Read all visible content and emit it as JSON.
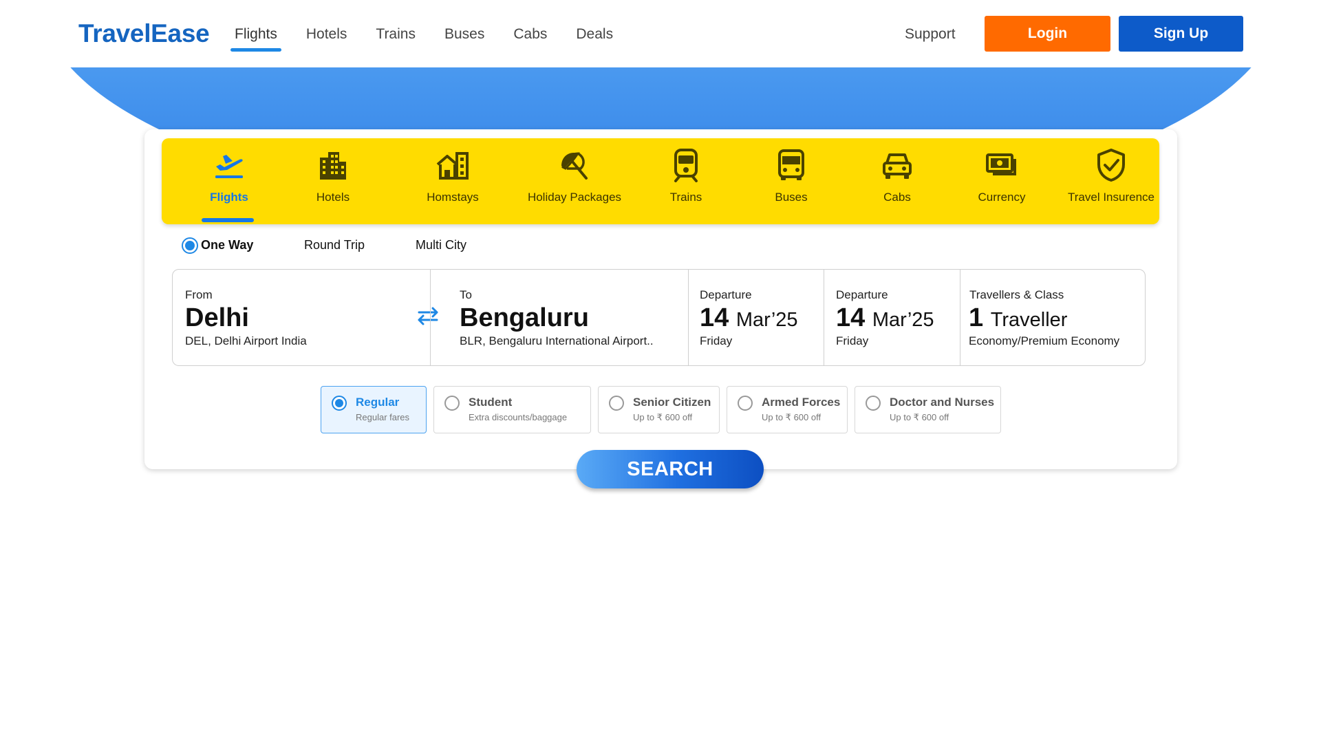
{
  "brand": {
    "name": "TravelEase",
    "color": "#1565c0"
  },
  "nav": {
    "items": [
      {
        "label": "Flights",
        "active": true
      },
      {
        "label": "Hotels"
      },
      {
        "label": "Trains"
      },
      {
        "label": "Buses"
      },
      {
        "label": "Cabs"
      },
      {
        "label": "Deals"
      }
    ],
    "support": "Support",
    "login": "Login",
    "signup": "Sign Up"
  },
  "categories": [
    {
      "label": "Flights",
      "icon": "plane-takeoff-icon",
      "active": true
    },
    {
      "label": "Hotels",
      "icon": "building-icon"
    },
    {
      "label": "Homstays",
      "icon": "homestay-icon"
    },
    {
      "label": "Holiday Packages",
      "icon": "beach-umbrella-icon"
    },
    {
      "label": "Trains",
      "icon": "train-icon"
    },
    {
      "label": "Buses",
      "icon": "bus-icon"
    },
    {
      "label": "Cabs",
      "icon": "car-icon"
    },
    {
      "label": "Currency",
      "icon": "banknote-icon"
    },
    {
      "label": "Travel Insurence",
      "icon": "shield-check-icon"
    }
  ],
  "trip_types": [
    {
      "label": "One Way",
      "selected": true
    },
    {
      "label": "Round Trip"
    },
    {
      "label": "Multi City"
    }
  ],
  "search": {
    "from": {
      "label": "From",
      "city": "Delhi",
      "detail": "DEL, Delhi Airport India"
    },
    "to": {
      "label": "To",
      "city": "Bengaluru",
      "detail": "BLR, Bengaluru International Airport.."
    },
    "departure": {
      "label": "Departure",
      "day": "14",
      "month": "Mar’25",
      "weekday": "Friday"
    },
    "return": {
      "label": "Departure",
      "day": "14",
      "month": "Mar’25",
      "weekday": "Friday"
    },
    "travellers": {
      "label": "Travellers & Class",
      "count": "1",
      "unit": "Traveller",
      "class": "Economy/Premium Economy"
    }
  },
  "fares": [
    {
      "title": "Regular",
      "sub": "Regular fares",
      "selected": true
    },
    {
      "title": "Student",
      "sub": "Extra discounts/baggage"
    },
    {
      "title": "Senior Citizen",
      "sub": "Up to ₹ 600 off"
    },
    {
      "title": "Armed Forces",
      "sub": "Up to ₹ 600 off"
    },
    {
      "title": "Doctor and Nurses",
      "sub": "Up to ₹ 600 off"
    }
  ],
  "search_button": "SEARCH",
  "colors": {
    "accent_blue": "#1e88e5",
    "login_orange": "#ff6a00",
    "signup_blue": "#0d5bc9",
    "category_bar_yellow": "#ffdc00",
    "hero_blue": "#3b8ae9"
  }
}
